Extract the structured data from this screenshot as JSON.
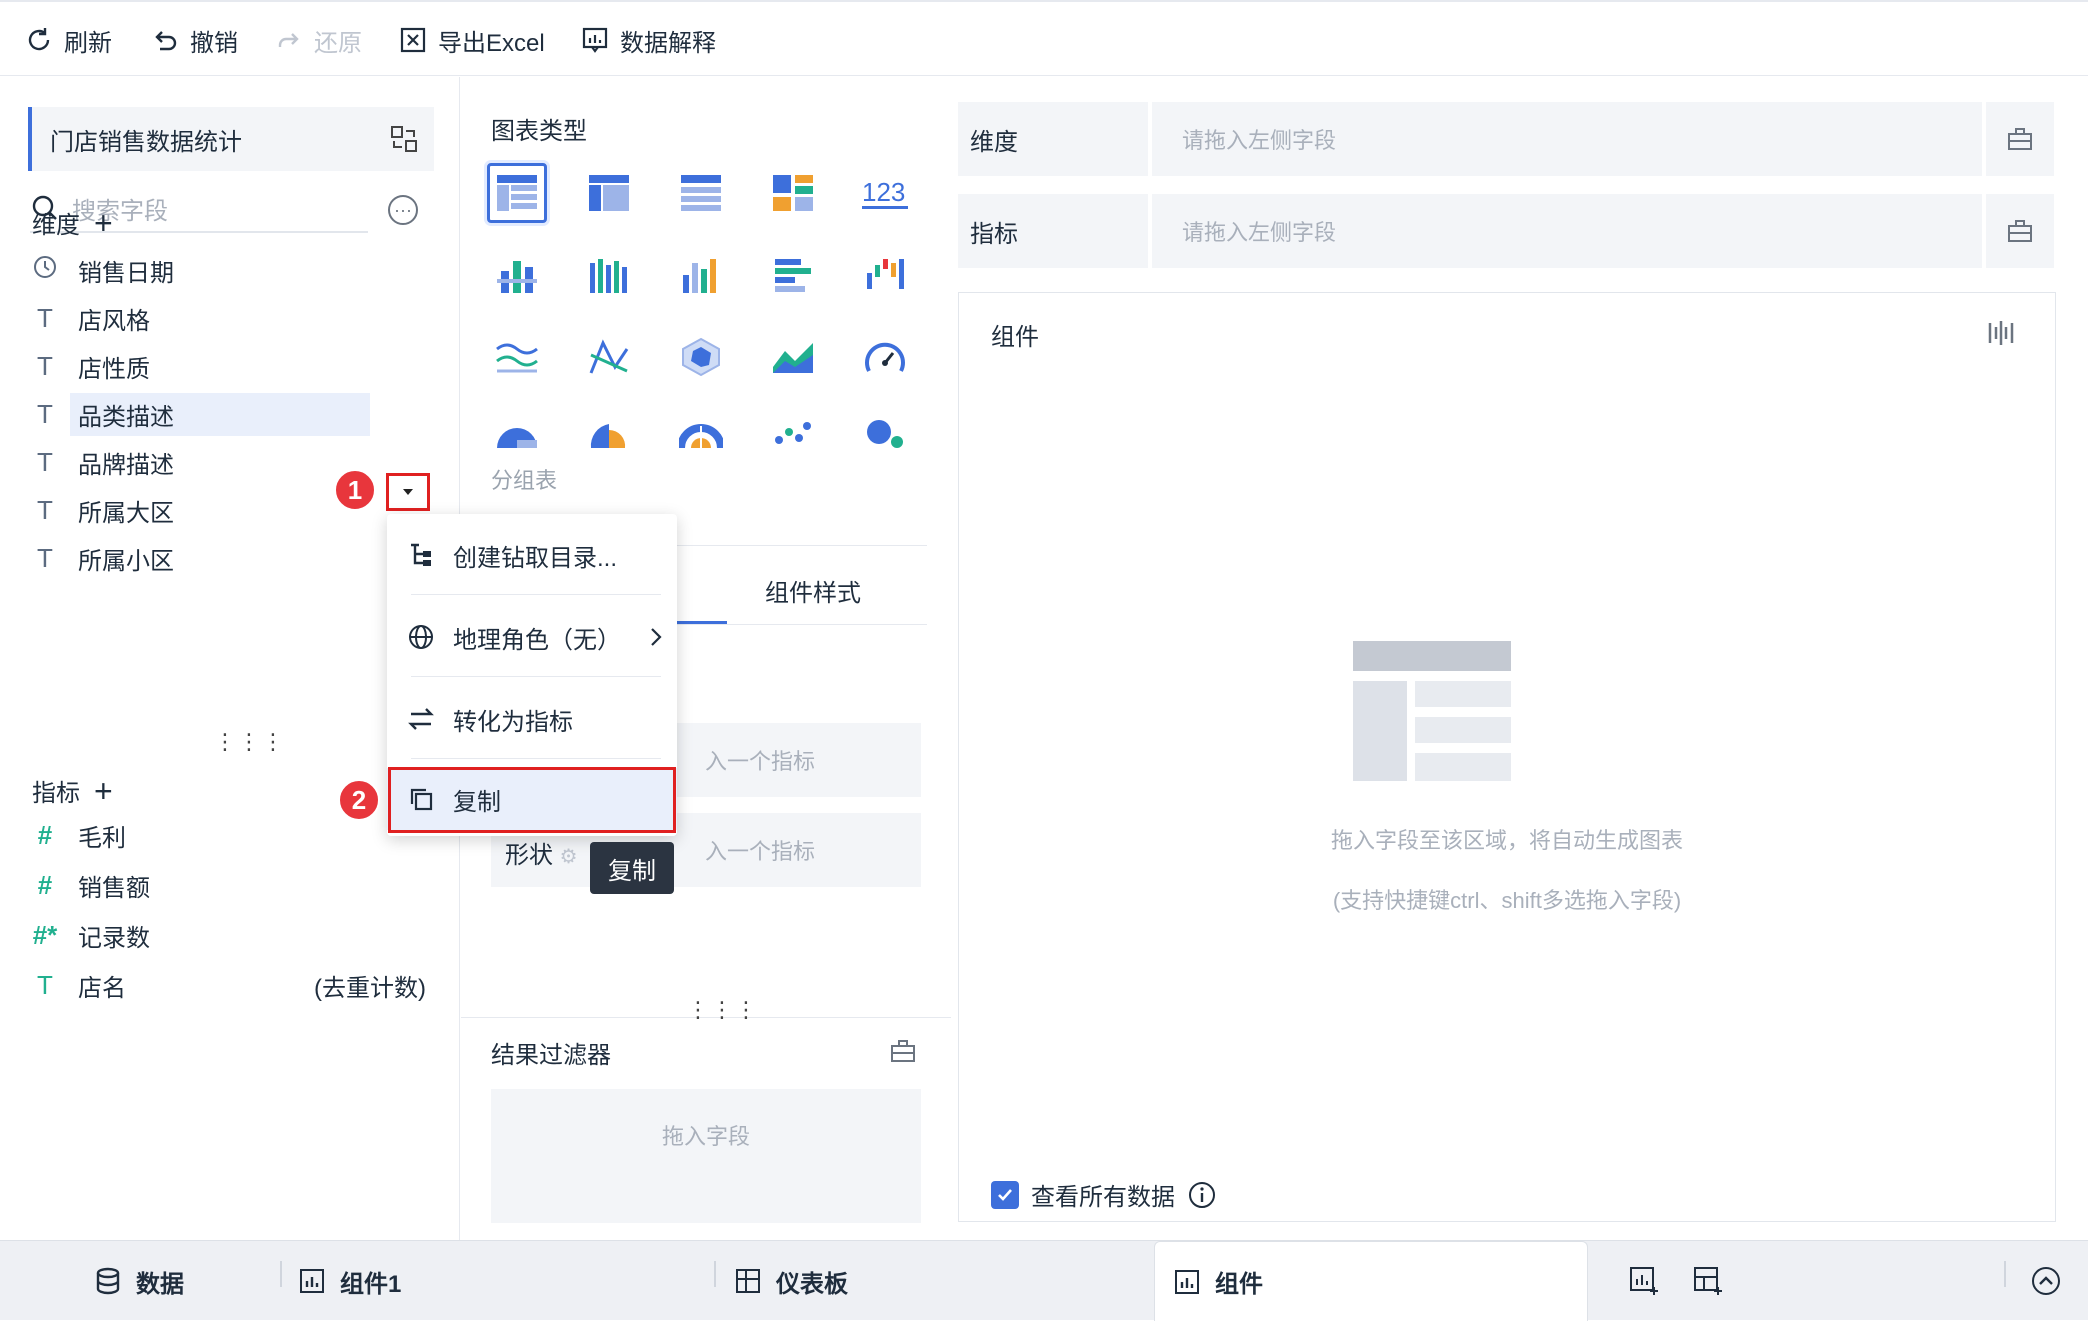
{
  "toolbar": {
    "refresh": "刷新",
    "undo": "撤销",
    "redo": "还原",
    "export": "导出Excel",
    "explain": "数据解释"
  },
  "left": {
    "dataset_name": "门店销售数据统计",
    "search_placeholder": "搜索字段",
    "dimensions_title": "维度",
    "dimensions": [
      {
        "label": "销售日期",
        "type": "date"
      },
      {
        "label": "店风格",
        "type": "text"
      },
      {
        "label": "店性质",
        "type": "text"
      },
      {
        "label": "品类描述",
        "type": "text"
      },
      {
        "label": "品牌描述",
        "type": "text"
      },
      {
        "label": "所属大区",
        "type": "text"
      },
      {
        "label": "所属小区",
        "type": "text"
      }
    ],
    "metrics_title": "指标",
    "metrics": [
      {
        "label": "毛利",
        "type": "number",
        "suffix": ""
      },
      {
        "label": "销售额",
        "type": "number",
        "suffix": ""
      },
      {
        "label": "记录数",
        "type": "count",
        "suffix": ""
      },
      {
        "label": "店名",
        "type": "text",
        "suffix": "(去重计数)"
      }
    ]
  },
  "badges": {
    "one": "1",
    "two": "2"
  },
  "context_menu": {
    "items": [
      "创建钻取目录...",
      "地理角色（无）",
      "转化为指标",
      "复制"
    ]
  },
  "tooltip": "复制",
  "middle": {
    "chart_type_title": "图表类型",
    "selected_chart_name": "分组表",
    "tab_style": "组件样式",
    "slot1_placeholder": "入一个指标",
    "slot2_label": "形状",
    "slot2_placeholder": "入一个指标",
    "filter_title": "结果过滤器",
    "filter_placeholder": "拖入字段"
  },
  "right": {
    "dimension_label": "维度",
    "dimension_placeholder": "请拖入左侧字段",
    "metric_label": "指标",
    "metric_placeholder": "请拖入左侧字段",
    "canvas_title": "组件",
    "hint1": "拖入字段至该区域，将自动生成图表",
    "hint2": "(支持快捷键ctrl、shift多选拖入字段)",
    "view_all": "查看所有数据"
  },
  "bottom": {
    "tabs": [
      "数据",
      "组件1",
      "仪表板",
      "组件"
    ]
  },
  "colors": {
    "accent": "#3d6fdb",
    "highlight": "#e02020",
    "green": "#21b08f"
  }
}
